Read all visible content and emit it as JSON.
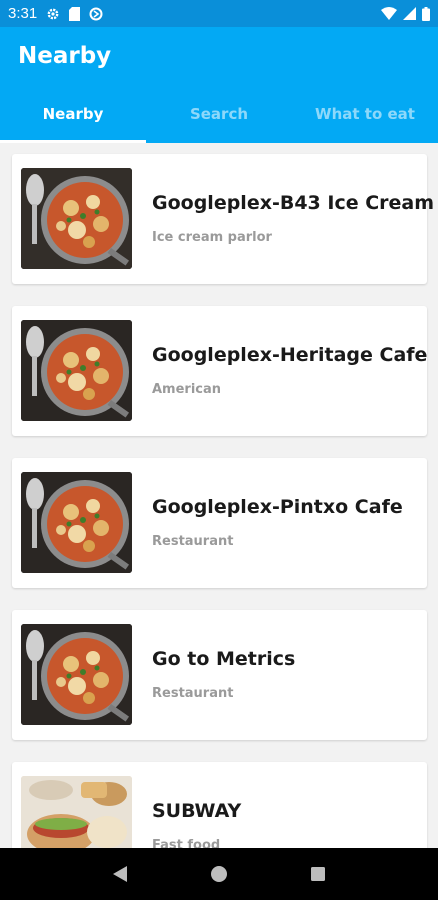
{
  "status_bar": {
    "time": "3:31"
  },
  "app_bar": {
    "title": "Nearby",
    "tabs": [
      {
        "label": "Nearby",
        "active": true
      },
      {
        "label": "Search",
        "active": false
      },
      {
        "label": "What to eat",
        "active": false
      }
    ]
  },
  "places": [
    {
      "name": "Googleplex-B43 Ice Cream",
      "category": "Ice cream parlor",
      "image": "pasta-dish"
    },
    {
      "name": "Googleplex-Heritage Cafe",
      "category": "American",
      "image": "pasta-dish"
    },
    {
      "name": "Googleplex-Pintxo Cafe",
      "category": "Restaurant",
      "image": "pasta-dish"
    },
    {
      "name": "Go to Metrics",
      "category": "Restaurant",
      "image": "pasta-dish"
    },
    {
      "name": "SUBWAY",
      "category": "Fast food",
      "image": "sandwich-platter"
    }
  ],
  "colors": {
    "status_bar": "#0a8fd9",
    "app_bar": "#03a9f4",
    "nav_bar": "#000000"
  }
}
